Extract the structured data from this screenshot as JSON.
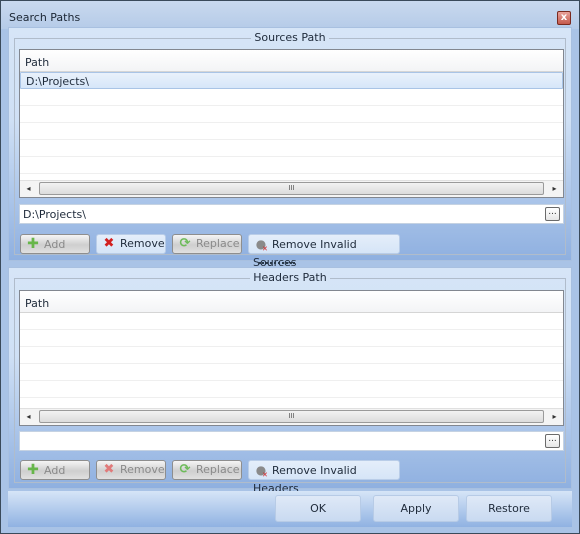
{
  "window": {
    "title": "Search Paths",
    "close_icon": "close-icon"
  },
  "sources": {
    "legend": "Sources Path",
    "column_header": "Path",
    "rows": [
      "D:\\Projects\\"
    ],
    "selected_row": 0,
    "input_value": "D:\\Projects\\",
    "browse_label": "...",
    "buttons": [
      {
        "label": "Add",
        "icon": "plus-icon",
        "enabled": false
      },
      {
        "label": "Remove",
        "icon": "remove-x-icon",
        "enabled": true
      },
      {
        "label": "Replace",
        "icon": "replace-refresh-icon",
        "enabled": false
      },
      {
        "label": "Remove Invalid Sources",
        "icon": "remove-invalid-icon",
        "enabled": true
      }
    ]
  },
  "headers": {
    "legend": "Headers Path",
    "column_header": "Path",
    "rows": [],
    "input_value": "",
    "browse_label": "...",
    "buttons": [
      {
        "label": "Add",
        "icon": "plus-icon",
        "enabled": false
      },
      {
        "label": "Remove",
        "icon": "remove-x-icon",
        "enabled": false
      },
      {
        "label": "Replace",
        "icon": "replace-refresh-icon",
        "enabled": false
      },
      {
        "label": "Remove Invalid Headers",
        "icon": "remove-invalid-icon",
        "enabled": true
      }
    ]
  },
  "scrollbar": {
    "left_arrow": "◂",
    "right_arrow": "▸",
    "grip": "III"
  },
  "footer": {
    "ok_label": "OK",
    "apply_label": "Apply",
    "restore_label": "Restore"
  }
}
